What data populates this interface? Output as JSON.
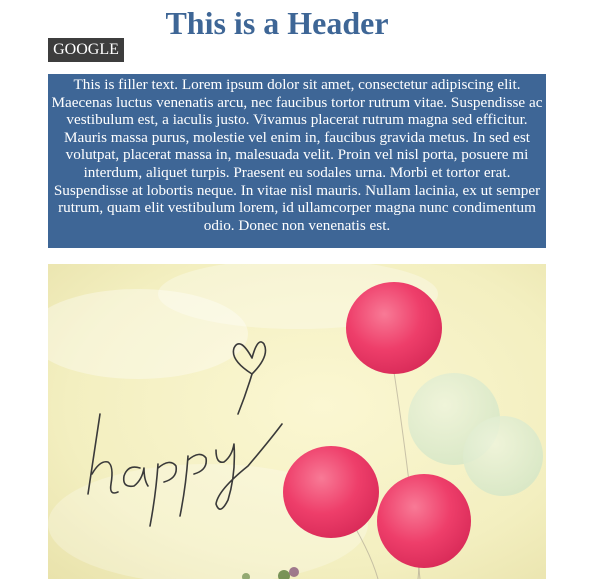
{
  "header": {
    "title": "This is a Header"
  },
  "google_link": {
    "label": "GOOGLE"
  },
  "filler": {
    "text": "This is filler text. Lorem ipsum dolor sit amet, consectetur adipiscing elit. Maecenas luctus venenatis arcu, nec faucibus tortor rutrum vitae. Suspendisse ac vestibulum est, a iaculis justo. Vivamus placerat rutrum magna sed efficitur. Mauris massa purus, molestie vel enim in, faucibus gravida metus. In sed est volutpat, placerat massa in, malesuada velit. Proin vel nisl porta, posuere mi interdum, aliquet turpis. Praesent eu sodales urna. Morbi et tortor erat. Suspendisse at lobortis neque. In vitae nisl mauris. Nullam lacinia, ex ut semper rutrum, quam elit vestibulum lorem, id ullamcorper magna nunc condimentum odio. Donec non venenatis est."
  },
  "photo": {
    "handwriting": "happy",
    "colors": {
      "sky": "#f3efc0",
      "balloon": "#ee3e6a",
      "faded_balloon": "#d9ebcf",
      "ink": "#3a3a3a"
    }
  },
  "theme": {
    "accent": "#3e6696",
    "button_bg": "#3d3d3d"
  }
}
